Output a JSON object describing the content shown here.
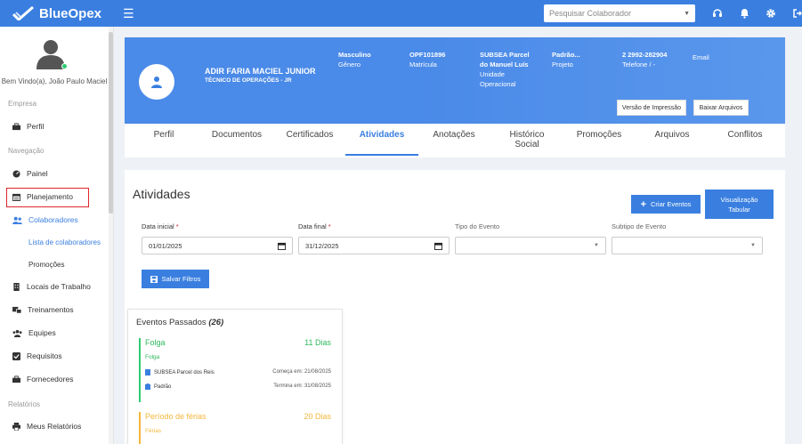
{
  "app": {
    "brand": "BlueOpex",
    "accent": "#3a7fe0"
  },
  "topbar": {
    "search_placeholder": "Pesquisar Colaborador",
    "icons": [
      "headset-icon",
      "bell-icon",
      "gear-icon",
      "logout-icon"
    ]
  },
  "sidebar": {
    "welcome": "Bem Vindo(a), João Paulo Maciel",
    "sections": {
      "empresa": "Empresa",
      "navegacao": "Navegação",
      "relatorios": "Relatórios"
    },
    "items": {
      "perfil": "Perfil",
      "painel": "Painel",
      "planejamento": "Planejamento",
      "colaboradores": "Colaboradores",
      "lista": "Lista de colaboradores",
      "promocoes": "Promoções",
      "locais": "Locais de Trabalho",
      "treinamentos": "Treinamentos",
      "equipes": "Equipes",
      "requisitos": "Requisitos",
      "fornecedores": "Fornecedores",
      "relatorios": "Meus Relatórios"
    }
  },
  "profile": {
    "name": "ADIR FARIA MACIEL JUNIOR",
    "role": "TÉCNICO DE OPERAÇÕES - JR",
    "gender_value": "Masculino",
    "gender_label": "Gênero",
    "matricula_value": "OPF101896",
    "matricula_label": "Matrícula",
    "unit_value_1": "SUBSEA Parcel",
    "unit_value_2": "do Manuel Luís",
    "unit_label_1": "Unidade",
    "unit_label_2": "Operacional",
    "project_value": "Padrão...",
    "project_label": "Projeto",
    "phone_value": "2 2992-282904",
    "phone_label": "Telefone / -",
    "email_label": "Email",
    "print_button": "Versão de Impressão",
    "download_button": "Baixar Arquivos"
  },
  "tabs": [
    {
      "label": "Perfil"
    },
    {
      "label": "Documentos"
    },
    {
      "label": "Certificados"
    },
    {
      "label": "Atividades"
    },
    {
      "label": "Anotações"
    },
    {
      "label": "Histórico",
      "label2": "Social"
    },
    {
      "label": "Promoções"
    },
    {
      "label": "Arquivos"
    },
    {
      "label": "Conflitos"
    }
  ],
  "activities": {
    "title": "Atividades",
    "create_button": "Criar Eventos",
    "tabular_button_1": "Visualização",
    "tabular_button_2": "Tabular",
    "filters": {
      "start_label": "Data inicial",
      "start_value": "01/01/2025",
      "end_label": "Data final",
      "end_value": "31/12/2025",
      "type_label": "Tipo do Evento",
      "type_value": "",
      "subtype_label": "Subtipo de Evento",
      "subtype_value": ""
    },
    "save_button": "Salvar Filtros",
    "past_events": {
      "title": "Eventos Passados",
      "count": "(26)",
      "events": [
        {
          "name": "Folga",
          "duration": "11 Dias",
          "sub": "Folga",
          "location": "SUBSEA Parcel dos Reis",
          "project": "Padrão",
          "start": "Começa em: 21/08/2025",
          "end": "Termina em: 31/08/2025",
          "color": "#2eb85c"
        },
        {
          "name": "Período de férias",
          "duration": "20 Dias",
          "sub": "Férias",
          "color": "#f4b73b"
        }
      ]
    }
  }
}
